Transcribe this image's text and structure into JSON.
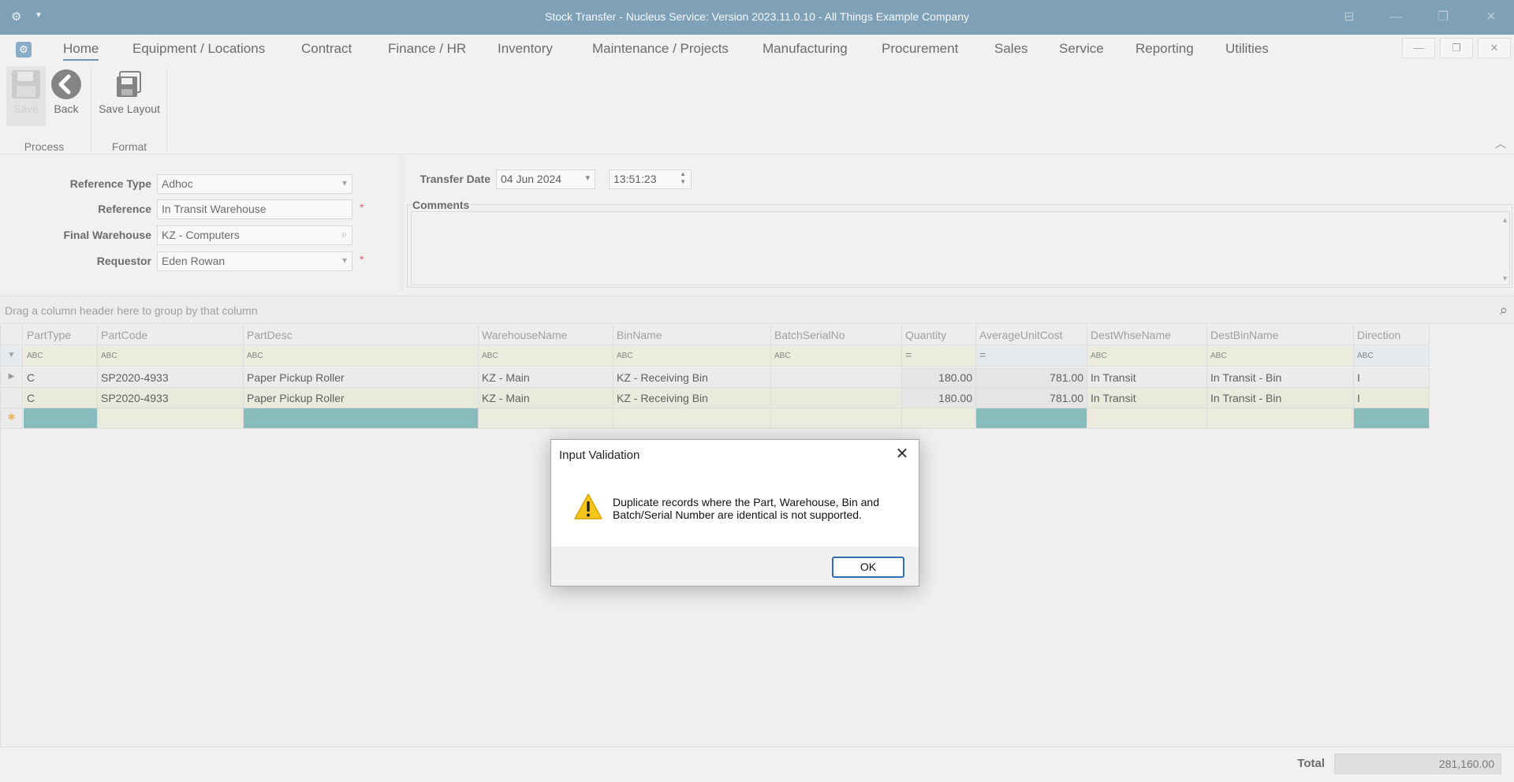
{
  "titlebar": {
    "title": "Stock Transfer - Nucleus Service: Version 2023.11.0.10 - All Things Example Company",
    "app_icon": "gear-icon"
  },
  "menu": {
    "items": [
      "Home",
      "Equipment / Locations",
      "Contract",
      "Finance / HR",
      "Inventory",
      "Maintenance / Projects",
      "Manufacturing",
      "Procurement",
      "Sales",
      "Service",
      "Reporting",
      "Utilities"
    ],
    "active": "Home"
  },
  "ribbon": {
    "save_label": "Save",
    "back_label": "Back",
    "save_layout_label": "Save Layout",
    "group_process": "Process",
    "group_format": "Format"
  },
  "form": {
    "reference_type_label": "Reference Type",
    "reference_type_value": "Adhoc",
    "reference_label": "Reference",
    "reference_value": "In Transit Warehouse",
    "final_warehouse_label": "Final Warehouse",
    "final_warehouse_value": "KZ - Computers",
    "requestor_label": "Requestor",
    "requestor_value": "Eden Rowan",
    "required_mark": "*",
    "transfer_date_label": "Transfer Date",
    "transfer_date_value": "04 Jun 2024",
    "transfer_time_value": "13:51:23",
    "comments_label": "Comments",
    "comments_value": ""
  },
  "grid": {
    "group_hint": "Drag a column header here to group by that column",
    "columns": [
      "PartType",
      "PartCode",
      "PartDesc",
      "WarehouseName",
      "BinName",
      "BatchSerialNo",
      "Quantity",
      "AverageUnitCost",
      "DestWhseName",
      "DestBinName",
      "Direction"
    ],
    "filter_text_icon": "ABC",
    "filter_num_icon": "=",
    "rows": [
      {
        "PartType": "C",
        "PartCode": "SP2020-4933",
        "PartDesc": "Paper Pickup Roller",
        "WarehouseName": "KZ - Main",
        "BinName": "KZ - Receiving Bin",
        "BatchSerialNo": "",
        "Quantity": "180.00",
        "AverageUnitCost": "781.00",
        "DestWhseName": "In Transit",
        "DestBinName": "In Transit - Bin",
        "Direction": "I"
      },
      {
        "PartType": "C",
        "PartCode": "SP2020-4933",
        "PartDesc": "Paper Pickup Roller",
        "WarehouseName": "KZ - Main",
        "BinName": "KZ - Receiving Bin",
        "BatchSerialNo": "",
        "Quantity": "180.00",
        "AverageUnitCost": "781.00",
        "DestWhseName": "In Transit",
        "DestBinName": "In Transit - Bin",
        "Direction": "I"
      }
    ]
  },
  "footer": {
    "total_label": "Total",
    "total_value": "281,160.00"
  },
  "dialog": {
    "title": "Input Validation",
    "message": "Duplicate records where the Part, Warehouse, Bin and Batch/Serial Number are identical is not supported.",
    "ok_label": "OK",
    "icon": "warning-icon"
  },
  "colors": {
    "titlebar": "#4e7d9c",
    "accent": "#2e6fb4",
    "new_row_highlight": "#5aa3a2"
  }
}
